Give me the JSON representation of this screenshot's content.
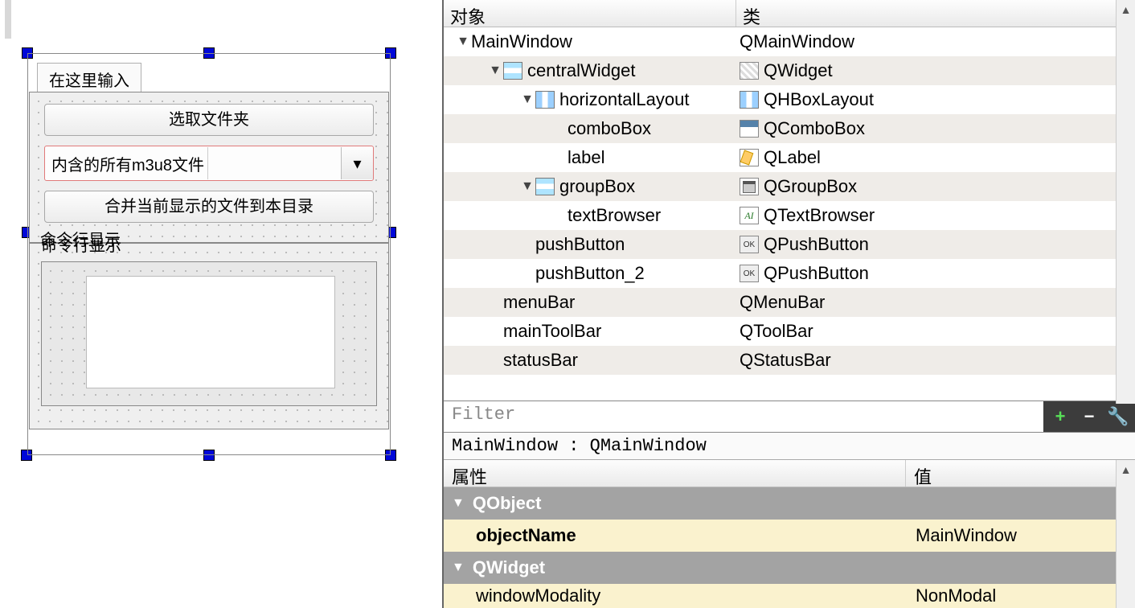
{
  "designer": {
    "tab_label": "在这里输入",
    "btn_select_folder": "选取文件夹",
    "combo_label": "内含的所有m3u8文件",
    "btn_merge": "合并当前显示的文件到本目录",
    "groupbox_title": "命令行显示"
  },
  "inspector": {
    "col_object": "对象",
    "col_class": "类",
    "rows": [
      {
        "indent": 0,
        "arrow": true,
        "icon": "",
        "name": "MainWindow",
        "cls": "QMainWindow",
        "cicon": ""
      },
      {
        "indent": 1,
        "arrow": true,
        "icon": "vbox",
        "name": "centralWidget",
        "cls": "QWidget",
        "cicon": "widget"
      },
      {
        "indent": 2,
        "arrow": true,
        "icon": "hbox",
        "name": "horizontalLayout",
        "cls": "QHBoxLayout",
        "cicon": "hbox"
      },
      {
        "indent": 3,
        "arrow": false,
        "icon": "",
        "name": "comboBox",
        "cls": "QComboBox",
        "cicon": "combo"
      },
      {
        "indent": 3,
        "arrow": false,
        "icon": "",
        "name": "label",
        "cls": "QLabel",
        "cicon": "label"
      },
      {
        "indent": 2,
        "arrow": true,
        "icon": "vbox",
        "name": "groupBox",
        "cls": "QGroupBox",
        "cicon": "group"
      },
      {
        "indent": 3,
        "arrow": false,
        "icon": "",
        "name": "textBrowser",
        "cls": "QTextBrowser",
        "cicon": "text"
      },
      {
        "indent": 2,
        "arrow": false,
        "icon": "",
        "name": "pushButton",
        "cls": "QPushButton",
        "cicon": "push"
      },
      {
        "indent": 2,
        "arrow": false,
        "icon": "",
        "name": "pushButton_2",
        "cls": "QPushButton",
        "cicon": "push"
      },
      {
        "indent": 1,
        "arrow": false,
        "icon": "",
        "name": "menuBar",
        "cls": "QMenuBar",
        "cicon": ""
      },
      {
        "indent": 1,
        "arrow": false,
        "icon": "",
        "name": "mainToolBar",
        "cls": "QToolBar",
        "cicon": ""
      },
      {
        "indent": 1,
        "arrow": false,
        "icon": "",
        "name": "statusBar",
        "cls": "QStatusBar",
        "cicon": ""
      }
    ]
  },
  "filter": {
    "placeholder": "Filter"
  },
  "selected": "MainWindow : QMainWindow",
  "props": {
    "col_name": "属性",
    "col_value": "值",
    "section1": "QObject",
    "objectName_label": "objectName",
    "objectName_value": "MainWindow",
    "section2": "QWidget",
    "windowModality_label": "windowModality",
    "windowModality_value": "NonModal"
  }
}
